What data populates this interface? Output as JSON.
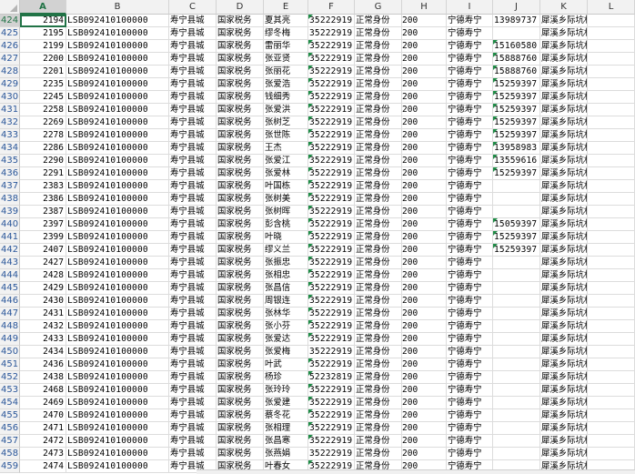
{
  "columns": [
    "A",
    "B",
    "C",
    "D",
    "E",
    "F",
    "G",
    "H",
    "I",
    "J",
    "K",
    "L"
  ],
  "selected_column": "A",
  "active_row_index": 0,
  "rows": [
    {
      "num": "424",
      "a": "2194",
      "b": "LSB092410100000",
      "c": "寿宁县城",
      "d": "国家税务",
      "e": "夏其亮",
      "f": "35222919",
      "g": "正常身份",
      "h": "200",
      "i": "宁德寿宁",
      "j": "13989737",
      "k": "犀溪乡际坑村",
      "l": "",
      "fg": true,
      "jg": false
    },
    {
      "num": "425",
      "a": "2195",
      "b": "LSB092410100000",
      "c": "寿宁县城",
      "d": "国家税务",
      "e": "缪冬梅",
      "f": "35222919",
      "g": "正常身份",
      "h": "200",
      "i": "宁德寿宁",
      "j": "",
      "k": "犀溪乡际坑村",
      "l": "",
      "fg": false,
      "jg": false
    },
    {
      "num": "426",
      "a": "2199",
      "b": "LSB092410100000",
      "c": "寿宁县城",
      "d": "国家税务",
      "e": "雷丽华",
      "f": "35222919",
      "g": "正常身份",
      "h": "200",
      "i": "宁德寿宁",
      "j": "15160580",
      "k": "犀溪乡际坑村",
      "l": "",
      "fg": true,
      "jg": true
    },
    {
      "num": "427",
      "a": "2200",
      "b": "LSB092410100000",
      "c": "寿宁县城",
      "d": "国家税务",
      "e": "张亚贤",
      "f": "35222919",
      "g": "正常身份",
      "h": "200",
      "i": "宁德寿宁",
      "j": "15888760",
      "k": "犀溪乡际坑村",
      "l": "",
      "fg": true,
      "jg": true
    },
    {
      "num": "428",
      "a": "2201",
      "b": "LSB092410100000",
      "c": "寿宁县城",
      "d": "国家税务",
      "e": "张丽花",
      "f": "35222919",
      "g": "正常身份",
      "h": "200",
      "i": "宁德寿宁",
      "j": "15888760",
      "k": "犀溪乡际坑村",
      "l": "",
      "fg": true,
      "jg": true
    },
    {
      "num": "429",
      "a": "2235",
      "b": "LSB092410100000",
      "c": "寿宁县城",
      "d": "国家税务",
      "e": "张爱浩",
      "f": "35222919",
      "g": "正常身份",
      "h": "200",
      "i": "宁德寿宁",
      "j": "15259397",
      "k": "犀溪乡际坑村",
      "l": "",
      "fg": true,
      "jg": true
    },
    {
      "num": "430",
      "a": "2245",
      "b": "LSB092410100000",
      "c": "寿宁县城",
      "d": "国家税务",
      "e": "钱细秀",
      "f": "35222919",
      "g": "正常身份",
      "h": "200",
      "i": "宁德寿宁",
      "j": "15259397",
      "k": "犀溪乡际坑村",
      "l": "",
      "fg": true,
      "jg": true
    },
    {
      "num": "431",
      "a": "2258",
      "b": "LSB092410100000",
      "c": "寿宁县城",
      "d": "国家税务",
      "e": "张爱洪",
      "f": "35222919",
      "g": "正常身份",
      "h": "200",
      "i": "宁德寿宁",
      "j": "15259397",
      "k": "犀溪乡际坑村",
      "l": "",
      "fg": true,
      "jg": true
    },
    {
      "num": "432",
      "a": "2269",
      "b": "LSB092410100000",
      "c": "寿宁县城",
      "d": "国家税务",
      "e": "张树芝",
      "f": "35222919",
      "g": "正常身份",
      "h": "200",
      "i": "宁德寿宁",
      "j": "15259397",
      "k": "犀溪乡际坑村",
      "l": "",
      "fg": true,
      "jg": true
    },
    {
      "num": "433",
      "a": "2278",
      "b": "LSB092410100000",
      "c": "寿宁县城",
      "d": "国家税务",
      "e": "张世陈",
      "f": "35222919",
      "g": "正常身份",
      "h": "200",
      "i": "宁德寿宁",
      "j": "15259397",
      "k": "犀溪乡际坑村",
      "l": "",
      "fg": true,
      "jg": true
    },
    {
      "num": "434",
      "a": "2286",
      "b": "LSB092410100000",
      "c": "寿宁县城",
      "d": "国家税务",
      "e": "王杰",
      "f": "35222919",
      "g": "正常身份",
      "h": "200",
      "i": "宁德寿宁",
      "j": "13958983",
      "k": "犀溪乡际坑村",
      "l": "",
      "fg": true,
      "jg": true
    },
    {
      "num": "435",
      "a": "2290",
      "b": "LSB092410100000",
      "c": "寿宁县城",
      "d": "国家税务",
      "e": "张爱江",
      "f": "35222919",
      "g": "正常身份",
      "h": "200",
      "i": "宁德寿宁",
      "j": "13559616",
      "k": "犀溪乡际坑村",
      "l": "",
      "fg": true,
      "jg": true
    },
    {
      "num": "436",
      "a": "2291",
      "b": "LSB092410100000",
      "c": "寿宁县城",
      "d": "国家税务",
      "e": "张爱林",
      "f": "35222919",
      "g": "正常身份",
      "h": "200",
      "i": "宁德寿宁",
      "j": "15259397",
      "k": "犀溪乡际坑村",
      "l": "",
      "fg": true,
      "jg": true
    },
    {
      "num": "437",
      "a": "2383",
      "b": "LSB092410100000",
      "c": "寿宁县城",
      "d": "国家税务",
      "e": "叶国栋",
      "f": "35222919",
      "g": "正常身份",
      "h": "200",
      "i": "宁德寿宁",
      "j": "",
      "k": "犀溪乡际坑村",
      "l": "",
      "fg": true,
      "jg": false
    },
    {
      "num": "438",
      "a": "2386",
      "b": "LSB092410100000",
      "c": "寿宁县城",
      "d": "国家税务",
      "e": "张树美",
      "f": "35222919",
      "g": "正常身份",
      "h": "200",
      "i": "宁德寿宁",
      "j": "",
      "k": "犀溪乡际坑村",
      "l": "",
      "fg": true,
      "jg": false
    },
    {
      "num": "439",
      "a": "2387",
      "b": "LSB092410100000",
      "c": "寿宁县城",
      "d": "国家税务",
      "e": "张树晖",
      "f": "35222919",
      "g": "正常身份",
      "h": "200",
      "i": "宁德寿宁",
      "j": "",
      "k": "犀溪乡际坑村",
      "l": "",
      "fg": true,
      "jg": false
    },
    {
      "num": "440",
      "a": "2397",
      "b": "LSB092410100000",
      "c": "寿宁县城",
      "d": "国家税务",
      "e": "彭含桃",
      "f": "35222919",
      "g": "正常身份",
      "h": "200",
      "i": "宁德寿宁",
      "j": "15059397",
      "k": "犀溪乡际坑村",
      "l": "",
      "fg": true,
      "jg": true
    },
    {
      "num": "441",
      "a": "2399",
      "b": "LSB092410100000",
      "c": "寿宁县城",
      "d": "国家税务",
      "e": "叶晓",
      "f": "35222919",
      "g": "正常身份",
      "h": "200",
      "i": "宁德寿宁",
      "j": "15259397",
      "k": "犀溪乡际坑村",
      "l": "",
      "fg": true,
      "jg": true
    },
    {
      "num": "442",
      "a": "2407",
      "b": "LSB092410100000",
      "c": "寿宁县城",
      "d": "国家税务",
      "e": "缪义兰",
      "f": "35222919",
      "g": "正常身份",
      "h": "200",
      "i": "宁德寿宁",
      "j": "15259397",
      "k": "犀溪乡际坑村",
      "l": "",
      "fg": true,
      "jg": true
    },
    {
      "num": "443",
      "a": "2427",
      "b": "LSB092410100000",
      "c": "寿宁县城",
      "d": "国家税务",
      "e": "张振忠",
      "f": "35222919",
      "g": "正常身份",
      "h": "200",
      "i": "宁德寿宁",
      "j": "",
      "k": "犀溪乡际坑村",
      "l": "",
      "fg": true,
      "jg": false
    },
    {
      "num": "444",
      "a": "2428",
      "b": "LSB092410100000",
      "c": "寿宁县城",
      "d": "国家税务",
      "e": "张相忠",
      "f": "35222919",
      "g": "正常身份",
      "h": "200",
      "i": "宁德寿宁",
      "j": "",
      "k": "犀溪乡际坑村",
      "l": "",
      "fg": true,
      "jg": false
    },
    {
      "num": "445",
      "a": "2429",
      "b": "LSB092410100000",
      "c": "寿宁县城",
      "d": "国家税务",
      "e": "张昌信",
      "f": "35222919",
      "g": "正常身份",
      "h": "200",
      "i": "宁德寿宁",
      "j": "",
      "k": "犀溪乡际坑村",
      "l": "",
      "fg": true,
      "jg": false
    },
    {
      "num": "446",
      "a": "2430",
      "b": "LSB092410100000",
      "c": "寿宁县城",
      "d": "国家税务",
      "e": "周银连",
      "f": "35222919",
      "g": "正常身份",
      "h": "200",
      "i": "宁德寿宁",
      "j": "",
      "k": "犀溪乡际坑村",
      "l": "",
      "fg": true,
      "jg": false
    },
    {
      "num": "447",
      "a": "2431",
      "b": "LSB092410100000",
      "c": "寿宁县城",
      "d": "国家税务",
      "e": "张林华",
      "f": "35222919",
      "g": "正常身份",
      "h": "200",
      "i": "宁德寿宁",
      "j": "",
      "k": "犀溪乡际坑村",
      "l": "",
      "fg": true,
      "jg": false
    },
    {
      "num": "448",
      "a": "2432",
      "b": "LSB092410100000",
      "c": "寿宁县城",
      "d": "国家税务",
      "e": "张小芬",
      "f": "35222919",
      "g": "正常身份",
      "h": "200",
      "i": "宁德寿宁",
      "j": "",
      "k": "犀溪乡际坑村",
      "l": "",
      "fg": true,
      "jg": false
    },
    {
      "num": "449",
      "a": "2433",
      "b": "LSB092410100000",
      "c": "寿宁县城",
      "d": "国家税务",
      "e": "张爱达",
      "f": "35222919",
      "g": "正常身份",
      "h": "200",
      "i": "宁德寿宁",
      "j": "",
      "k": "犀溪乡际坑村",
      "l": "",
      "fg": true,
      "jg": false
    },
    {
      "num": "450",
      "a": "2434",
      "b": "LSB092410100000",
      "c": "寿宁县城",
      "d": "国家税务",
      "e": "张爱梅",
      "f": "35222919",
      "g": "正常身份",
      "h": "200",
      "i": "宁德寿宁",
      "j": "",
      "k": "犀溪乡际坑村",
      "l": "",
      "fg": false,
      "jg": false
    },
    {
      "num": "451",
      "a": "2436",
      "b": "LSB092410100000",
      "c": "寿宁县城",
      "d": "国家税务",
      "e": "叶武",
      "f": "35222919",
      "g": "正常身份",
      "h": "200",
      "i": "宁德寿宁",
      "j": "",
      "k": "犀溪乡际坑村",
      "l": "",
      "fg": true,
      "jg": false
    },
    {
      "num": "452",
      "a": "2438",
      "b": "LSB092410100000",
      "c": "寿宁县城",
      "d": "国家税务",
      "e": "杨珍",
      "f": "52232819",
      "g": "正常身份",
      "h": "200",
      "i": "宁德寿宁",
      "j": "",
      "k": "犀溪乡际坑村",
      "l": "",
      "fg": true,
      "jg": false
    },
    {
      "num": "453",
      "a": "2468",
      "b": "LSB092410100000",
      "c": "寿宁县城",
      "d": "国家税务",
      "e": "张玲玲",
      "f": "35222919",
      "g": "正常身份",
      "h": "200",
      "i": "宁德寿宁",
      "j": "",
      "k": "犀溪乡际坑村",
      "l": "",
      "fg": true,
      "jg": false
    },
    {
      "num": "454",
      "a": "2469",
      "b": "LSB092410100000",
      "c": "寿宁县城",
      "d": "国家税务",
      "e": "张爱建",
      "f": "35222919",
      "g": "正常身份",
      "h": "200",
      "i": "宁德寿宁",
      "j": "",
      "k": "犀溪乡际坑村",
      "l": "",
      "fg": true,
      "jg": false
    },
    {
      "num": "455",
      "a": "2470",
      "b": "LSB092410100000",
      "c": "寿宁县城",
      "d": "国家税务",
      "e": "蔡冬花",
      "f": "35222919",
      "g": "正常身份",
      "h": "200",
      "i": "宁德寿宁",
      "j": "",
      "k": "犀溪乡际坑村",
      "l": "",
      "fg": true,
      "jg": false
    },
    {
      "num": "456",
      "a": "2471",
      "b": "LSB092410100000",
      "c": "寿宁县城",
      "d": "国家税务",
      "e": "张相理",
      "f": "35222919",
      "g": "正常身份",
      "h": "200",
      "i": "宁德寿宁",
      "j": "",
      "k": "犀溪乡际坑村",
      "l": "",
      "fg": true,
      "jg": false
    },
    {
      "num": "457",
      "a": "2472",
      "b": "LSB092410100000",
      "c": "寿宁县城",
      "d": "国家税务",
      "e": "张昌寒",
      "f": "35222919",
      "g": "正常身份",
      "h": "200",
      "i": "宁德寿宁",
      "j": "",
      "k": "犀溪乡际坑村",
      "l": "",
      "fg": true,
      "jg": false
    },
    {
      "num": "458",
      "a": "2473",
      "b": "LSB092410100000",
      "c": "寿宁县城",
      "d": "国家税务",
      "e": "张燕娟",
      "f": "35222919",
      "g": "正常身份",
      "h": "200",
      "i": "宁德寿宁",
      "j": "",
      "k": "犀溪乡际坑村",
      "l": "",
      "fg": false,
      "jg": false
    },
    {
      "num": "459",
      "a": "2474",
      "b": "LSB092410100000",
      "c": "寿宁县城",
      "d": "国家税务",
      "e": "叶春女",
      "f": "35222919",
      "g": "正常身份",
      "h": "200",
      "i": "宁德寿宁",
      "j": "",
      "k": "犀溪乡际坑村",
      "l": "",
      "fg": true,
      "jg": false
    }
  ]
}
